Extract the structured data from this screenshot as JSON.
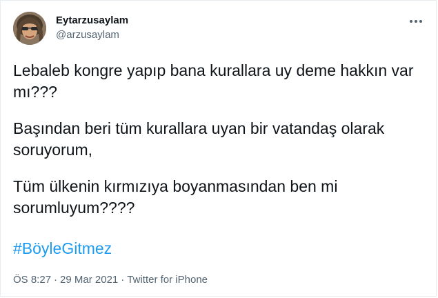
{
  "author": {
    "display_name": "Eytarzusaylam",
    "handle": "@arzusaylam"
  },
  "tweet": {
    "paragraphs": [
      "Lebaleb kongre yapıp bana kurallara uy deme hakkın var mı???",
      "Başından beri tüm kurallara uyan bir vatandaş olarak soruyorum,",
      "Tüm ülkenin kırmızıya boyanmasından ben mi sorumluyum????"
    ],
    "hashtag": "#BöyleGitmez"
  },
  "meta": {
    "time": "ÖS 8:27",
    "separator": "·",
    "date": "29 Mar 2021",
    "source": "Twitter for iPhone"
  },
  "icons": {
    "more": "more-horizontal-icon",
    "avatar": "profile-photo"
  },
  "colors": {
    "text": "#0f1419",
    "secondary": "#536471",
    "link": "#1d9bf0"
  }
}
